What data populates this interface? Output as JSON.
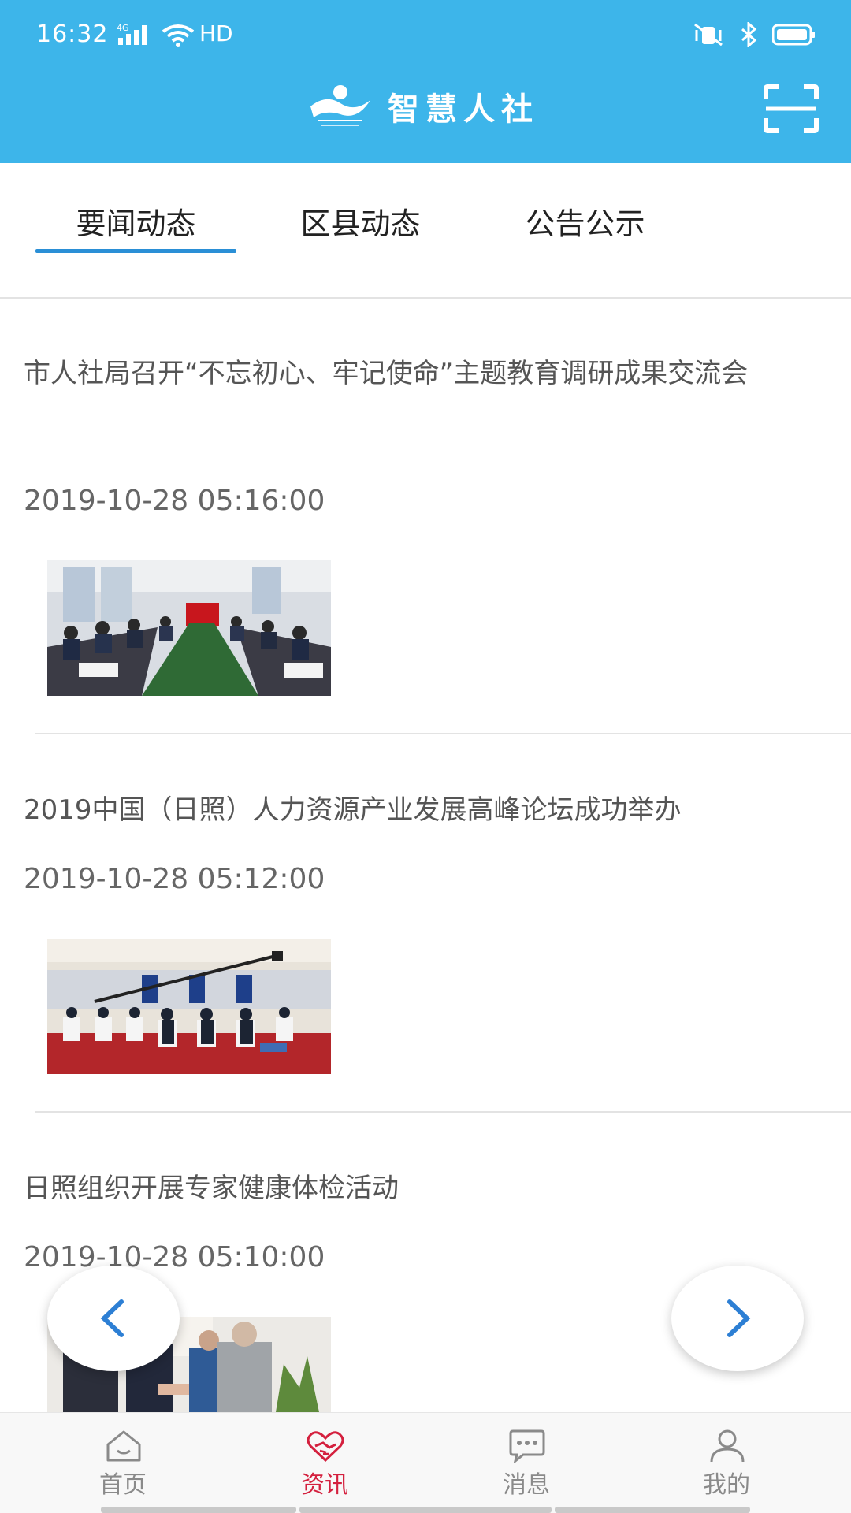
{
  "status_bar": {
    "time": "16:32",
    "network": "4G",
    "hd": "HD"
  },
  "header": {
    "app_title": "智慧人社"
  },
  "tabs": [
    {
      "label": "要闻动态",
      "active": true
    },
    {
      "label": "区县动态",
      "active": false
    },
    {
      "label": "公告公示",
      "active": false
    }
  ],
  "news": [
    {
      "title": "市人社局召开“不忘初心、牢记使命”主题教育调研成果交流会",
      "date": "2019-10-28 05:16:00",
      "thumb": "meeting-room-photo"
    },
    {
      "title": "2019中国（日照）人力资源产业发展高峰论坛成功举办",
      "date": "2019-10-28 05:12:00",
      "thumb": "conference-hall-photo"
    },
    {
      "title": "日照组织开展专家健康体检活动",
      "date": "2019-10-28 05:10:00",
      "thumb": "health-check-photo"
    }
  ],
  "bottom_nav": [
    {
      "label": "首页",
      "icon": "home-icon",
      "active": false
    },
    {
      "label": "资讯",
      "icon": "heart-hands-icon",
      "active": true
    },
    {
      "label": "消息",
      "icon": "message-icon",
      "active": false
    },
    {
      "label": "我的",
      "icon": "user-icon",
      "active": false
    }
  ],
  "colors": {
    "header": "#3db5ea",
    "tab_indicator": "#2a8fd6",
    "active_nav": "#d4203e"
  }
}
